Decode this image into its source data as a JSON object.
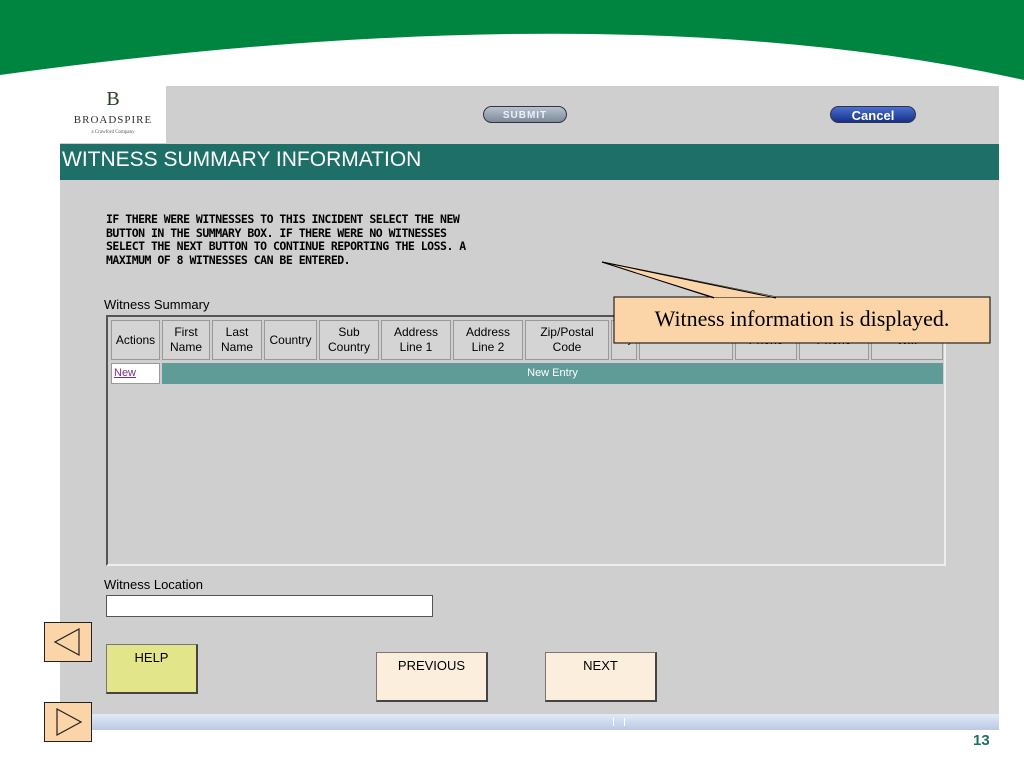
{
  "colors": {
    "slide_band": "#008540",
    "title_bar": "#1e6f68",
    "new_entry_row": "#5f9b97",
    "help_button": "#e3e58a",
    "nav_buttons": "#fbeedd",
    "callout_fill": "#fbd4a8"
  },
  "logo": {
    "mark": "B",
    "name": "BROADSPIRE",
    "tagline": "a Crawford Company"
  },
  "toolbar": {
    "submit_label": "SUBMIT",
    "cancel_label": "Cancel"
  },
  "page": {
    "title": "WITNESS SUMMARY INFORMATION",
    "instructions": [
      "IF THERE WERE WITNESSES TO THIS INCIDENT SELECT THE NEW",
      "BUTTON IN THE SUMMARY BOX. IF THERE WERE NO WITNESSES",
      "SELECT THE NEXT BUTTON TO CONTINUE REPORTING THE LOSS. A",
      "MAXIMUM OF 8 WITNESSES CAN BE ENTERED."
    ]
  },
  "summary": {
    "label": "Witness Summary",
    "columns": [
      "Actions",
      "First Name",
      "Last Name",
      "Country",
      "Sub Country",
      "Address Line 1",
      "Address Line 2",
      "Zip/Postal Code",
      "City",
      "State/Province",
      "Phone",
      "Phone",
      "W..."
    ],
    "new_link": "New",
    "new_entry_text": "New Entry"
  },
  "location": {
    "label": "Witness Location",
    "value": ""
  },
  "buttons": {
    "help": "HELP",
    "previous": "PREVIOUS",
    "next": "NEXT"
  },
  "callout": {
    "text": "Witness information is displayed."
  },
  "slide": {
    "page_number": "13",
    "prev_icon": "triangle-left-icon",
    "next_icon": "triangle-right-icon"
  }
}
